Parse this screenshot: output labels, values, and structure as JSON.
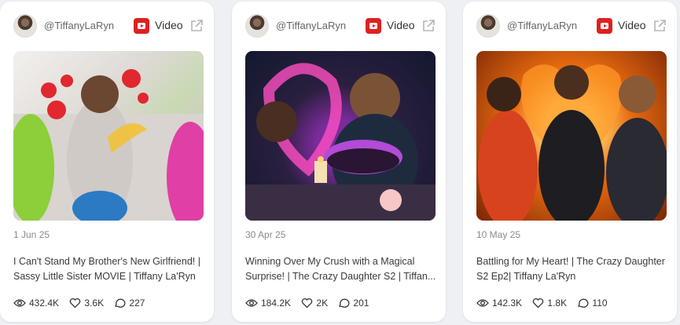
{
  "cards": [
    {
      "handle": "@TiffanyLaRyn",
      "type_label": "Video",
      "date": "1 Jun 25",
      "title": "I Can't Stand My Brother's New Girlfriend! | Sassy Little Sister MOVIE | Tiffany La'Ryn",
      "views": "432.4K",
      "likes": "3.6K",
      "comments": "227"
    },
    {
      "handle": "@TiffanyLaRyn",
      "type_label": "Video",
      "date": "30 Apr 25",
      "title": "Winning Over My Crush with a Magical Surprise! | The Crazy Daughter S2 | Tiffan...",
      "views": "184.2K",
      "likes": "2K",
      "comments": "201"
    },
    {
      "handle": "@TiffanyLaRyn",
      "type_label": "Video",
      "date": "10 May 25",
      "title": "Battling for My Heart! | The Crazy Daughter S2 Ep2| Tiffany La'Ryn",
      "views": "142.3K",
      "likes": "1.8K",
      "comments": "110"
    }
  ],
  "colors": {
    "youtube_red": "#e02020",
    "card_bg": "#ffffff",
    "page_bg": "#eef0f4"
  },
  "icons": [
    "youtube-icon",
    "external-link-icon",
    "eye-icon",
    "heart-icon",
    "comment-icon"
  ]
}
